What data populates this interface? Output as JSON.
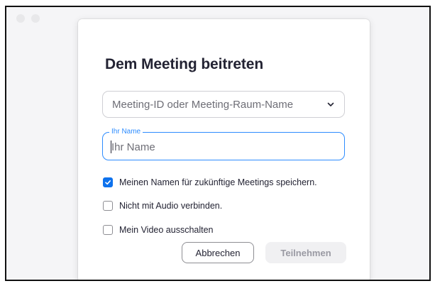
{
  "dialog": {
    "title": "Dem Meeting beitreten"
  },
  "meeting_field": {
    "placeholder": "Meeting-ID oder Meeting-Raum-Name",
    "dropdown_icon": "chevron-down-icon"
  },
  "name_field": {
    "label": "Ihr Name",
    "placeholder": "Ihr Name",
    "value": ""
  },
  "options": [
    {
      "label": "Meinen Namen für zukünftige Meetings speichern.",
      "checked": true
    },
    {
      "label": "Nicht mit Audio verbinden.",
      "checked": false
    },
    {
      "label": "Mein Video ausschalten",
      "checked": false
    }
  ],
  "buttons": {
    "cancel_label": "Abbrechen",
    "join_label": "Teilnehmen"
  },
  "colors": {
    "accent": "#2d8cff",
    "checkbox_checked": "#0e72ed",
    "title_text": "#232333"
  }
}
